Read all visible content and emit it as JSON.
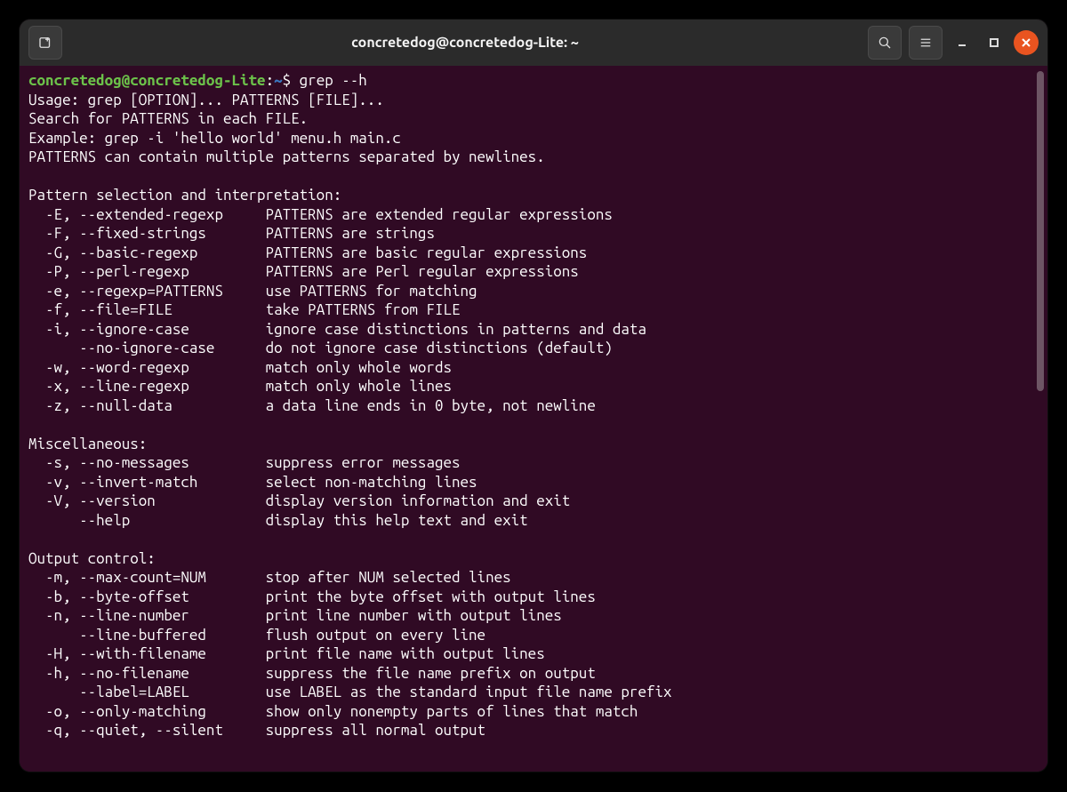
{
  "titlebar": {
    "title": "concretedog@concretedog-Lite: ~"
  },
  "prompt": {
    "userhost": "concretedog@concretedog-Lite",
    "colon": ":",
    "path": "~",
    "dollar": "$",
    "command": "grep --h"
  },
  "header_lines": [
    "Usage: grep [OPTION]... PATTERNS [FILE]...",
    "Search for PATTERNS in each FILE.",
    "Example: grep -i 'hello world' menu.h main.c",
    "PATTERNS can contain multiple patterns separated by newlines."
  ],
  "sections": [
    {
      "title": "Pattern selection and interpretation:",
      "options": [
        {
          "flags": "  -E, --extended-regexp     ",
          "desc": "PATTERNS are extended regular expressions"
        },
        {
          "flags": "  -F, --fixed-strings       ",
          "desc": "PATTERNS are strings"
        },
        {
          "flags": "  -G, --basic-regexp        ",
          "desc": "PATTERNS are basic regular expressions"
        },
        {
          "flags": "  -P, --perl-regexp         ",
          "desc": "PATTERNS are Perl regular expressions"
        },
        {
          "flags": "  -e, --regexp=PATTERNS     ",
          "desc": "use PATTERNS for matching"
        },
        {
          "flags": "  -f, --file=FILE           ",
          "desc": "take PATTERNS from FILE"
        },
        {
          "flags": "  -i, --ignore-case         ",
          "desc": "ignore case distinctions in patterns and data"
        },
        {
          "flags": "      --no-ignore-case      ",
          "desc": "do not ignore case distinctions (default)"
        },
        {
          "flags": "  -w, --word-regexp         ",
          "desc": "match only whole words"
        },
        {
          "flags": "  -x, --line-regexp         ",
          "desc": "match only whole lines"
        },
        {
          "flags": "  -z, --null-data           ",
          "desc": "a data line ends in 0 byte, not newline"
        }
      ]
    },
    {
      "title": "Miscellaneous:",
      "options": [
        {
          "flags": "  -s, --no-messages         ",
          "desc": "suppress error messages"
        },
        {
          "flags": "  -v, --invert-match        ",
          "desc": "select non-matching lines"
        },
        {
          "flags": "  -V, --version             ",
          "desc": "display version information and exit"
        },
        {
          "flags": "      --help                ",
          "desc": "display this help text and exit"
        }
      ]
    },
    {
      "title": "Output control:",
      "options": [
        {
          "flags": "  -m, --max-count=NUM       ",
          "desc": "stop after NUM selected lines"
        },
        {
          "flags": "  -b, --byte-offset         ",
          "desc": "print the byte offset with output lines"
        },
        {
          "flags": "  -n, --line-number         ",
          "desc": "print line number with output lines"
        },
        {
          "flags": "      --line-buffered       ",
          "desc": "flush output on every line"
        },
        {
          "flags": "  -H, --with-filename       ",
          "desc": "print file name with output lines"
        },
        {
          "flags": "  -h, --no-filename         ",
          "desc": "suppress the file name prefix on output"
        },
        {
          "flags": "      --label=LABEL         ",
          "desc": "use LABEL as the standard input file name prefix"
        },
        {
          "flags": "  -o, --only-matching       ",
          "desc": "show only nonempty parts of lines that match"
        },
        {
          "flags": "  -q, --quiet, --silent     ",
          "desc": "suppress all normal output"
        }
      ]
    }
  ]
}
